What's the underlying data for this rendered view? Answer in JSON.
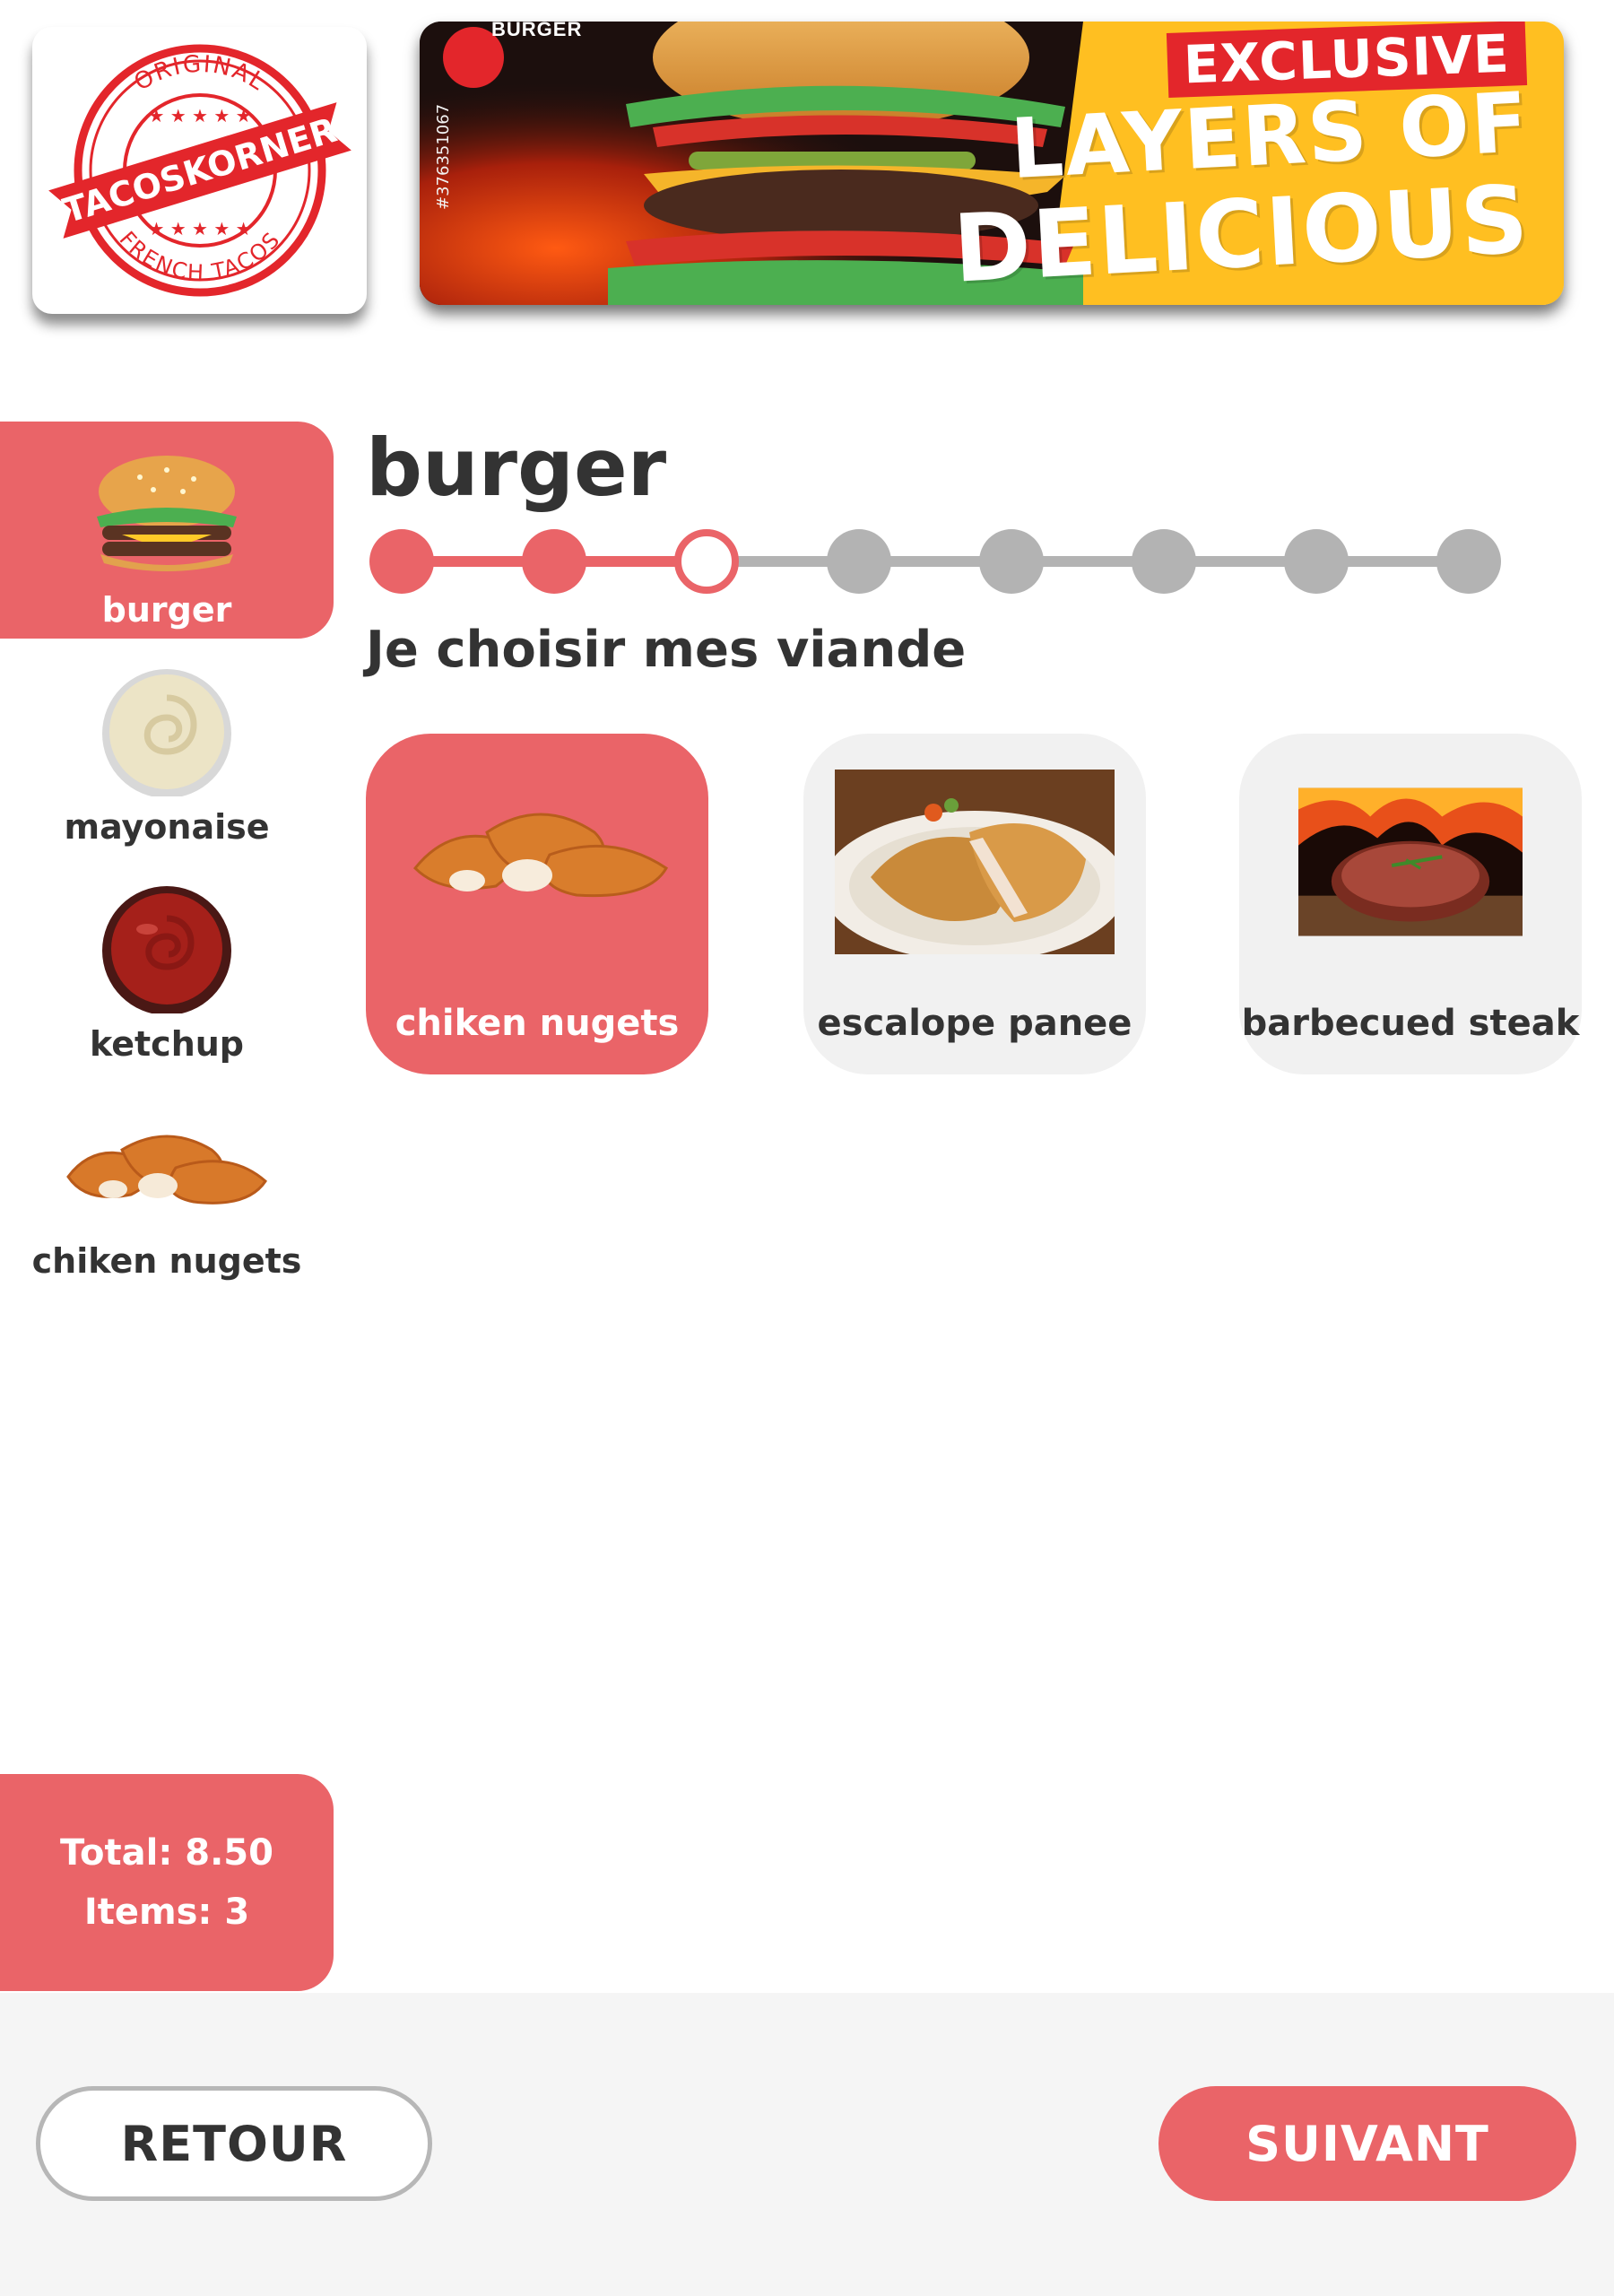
{
  "header": {
    "logo": {
      "top_text": "ORIGINAL",
      "brand": "TACOSKORNER",
      "bottom_text": "FRENCH TACOS",
      "brand_color": "#e3262b"
    },
    "banner": {
      "tag": "BURGER",
      "exclusive": "EXCLUSIVE",
      "line1": "LAYERS OF",
      "line2": "DELICIOUS",
      "stock_id": "#376351067"
    }
  },
  "sidebar": {
    "items": [
      {
        "label": "burger",
        "icon": "burger-icon",
        "active": true
      },
      {
        "label": "mayonaise",
        "icon": "mayonnaise-bowl-icon",
        "active": false
      },
      {
        "label": "ketchup",
        "icon": "ketchup-bowl-icon",
        "active": false
      },
      {
        "label": "chiken nugets",
        "icon": "chicken-nuggets-icon",
        "active": false
      }
    ],
    "summary": {
      "total": "Total: 8.50",
      "items": "Items: 3"
    }
  },
  "main": {
    "title": "burger",
    "subtitle": "Je choisir mes viande",
    "stepper": {
      "total_steps": 8,
      "completed_steps": 2,
      "current_step": 3
    },
    "options": [
      {
        "label": "chiken nugets",
        "image": "chicken-nuggets-image",
        "selected": true
      },
      {
        "label": "escalope panee",
        "image": "escalope-panee-image",
        "selected": false
      },
      {
        "label": "barbecued steak",
        "image": "barbecued-steak-image",
        "selected": false
      }
    ]
  },
  "footer": {
    "back_label": "RETOUR",
    "next_label": "SUIVANT"
  },
  "colors": {
    "accent": "#ea6468",
    "inactive_step": "#b3b3b3",
    "card_bg": "#f1f1f1",
    "text": "#333333"
  }
}
